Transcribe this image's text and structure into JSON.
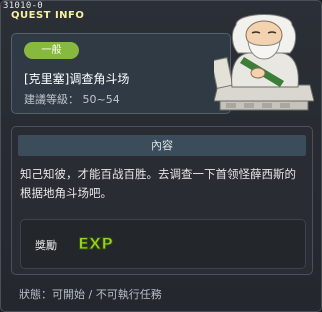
{
  "window": {
    "quest_id": "31010-0",
    "title": "QUEST INFO"
  },
  "header": {
    "category": "一般",
    "quest_name": "[克里塞]调查角斗场",
    "level_label": "建議等級：",
    "level_value": "50~54"
  },
  "content": {
    "section_title": "內容",
    "description": "知己知彼，才能百战百胜。去调查一下首领怪薛西斯的根据地角斗场吧。",
    "reward_label": "獎勵",
    "reward_icon": "exp-icon",
    "reward_text": "EXP"
  },
  "status": {
    "label": "狀態：",
    "value": "可開始 / 不可執行任務"
  },
  "colors": {
    "title": "#f6f0a6",
    "badge": "#86b93d",
    "exp": "#9bd21c"
  }
}
